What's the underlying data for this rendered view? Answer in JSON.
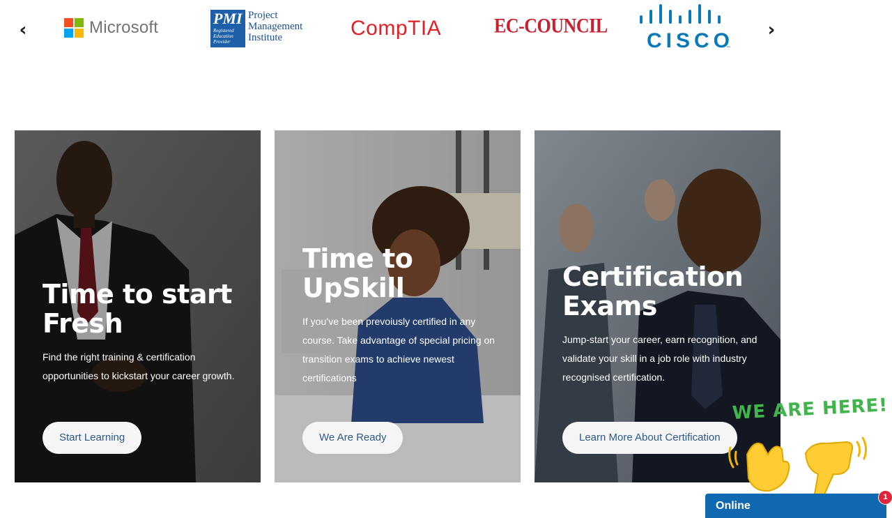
{
  "carousel": {
    "prev_icon": "chevron-left-icon",
    "next_icon": "chevron-right-icon",
    "prev_glyph": "‹",
    "next_glyph": "›",
    "logos": {
      "microsoft": "Microsoft",
      "pmi_mark": "PMI",
      "pmi_badge": [
        "Registered",
        "Education",
        "Provider"
      ],
      "pmi_lines": [
        "Project",
        "Management",
        "Institute"
      ],
      "comptia": "CompTIA",
      "eccouncil": "EC-COUNCIL",
      "cisco": "CISCO",
      "cisco_tm": "™"
    }
  },
  "cards": [
    {
      "title": "Time to start Fresh",
      "text": "Find the right training & certification opportunities to kickstart your career growth.",
      "button": "Start Learning"
    },
    {
      "title": "Time to UpSkill",
      "text": "If you’ve been prevoiusly certified in any course. Take advantage of special pricing on transition exams to achieve newest certifications",
      "button": "We Are Ready"
    },
    {
      "title": "Certification Exams",
      "text": "Jump-start your career, earn recognition, and validate your skill in a job role with industry recognised certification.",
      "button": "Learn More About Certification"
    }
  ],
  "chat": {
    "callout": "WE ARE HERE!",
    "status": "Online",
    "badge_count": "1",
    "icons": [
      "waving-hand-icon",
      "pointing-hand-icon"
    ]
  },
  "colors": {
    "accent": "#0f68b0",
    "badge": "#e0263a",
    "callout": "#3fb54b",
    "button_text": "#2b5a8a"
  }
}
